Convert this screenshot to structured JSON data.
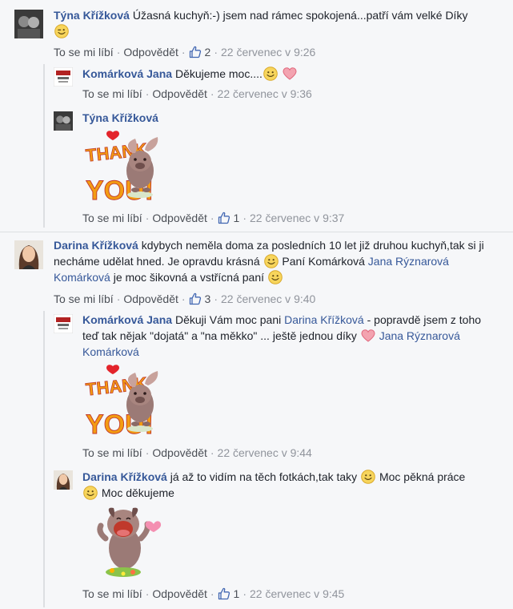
{
  "actions": {
    "like": "To se mi líbí",
    "reply": "Odpovědět",
    "sep": "·"
  },
  "comments": [
    {
      "author": "Týna Křížková",
      "text": "Úžasná kuchyň:-) jsem nad rámec spokojená...patří vám velké Díky",
      "likes": "2",
      "time": "22 červenec v 9:26",
      "replies": [
        {
          "author": "Komárková Jana",
          "text": "Děkujeme moc....",
          "time": "22 červenec v 9:36"
        },
        {
          "author": "Týna Křížková",
          "sticker": "thank-you-sticker",
          "likes": "1",
          "time": "22 červenec v 9:37"
        }
      ]
    },
    {
      "author": "Darina Křížková",
      "text_1": "kdybych neměla doma za posledních 10 let již druhou kuchyň,tak si ji necháme udělat hned. Je opravdu krásná",
      "text_2": "Paní Komárková",
      "tag_1": "Jana Rýznarová Komárková",
      "text_3": "je moc šikovná a vstřícná paní",
      "likes": "3",
      "time": "22 červenec v 9:40",
      "replies": [
        {
          "author": "Komárková Jana",
          "text_1": "Děkuji Vám moc pani",
          "tag_1": "Darina Křížková",
          "text_2": "- popravdě jsem z toho teď tak nějak \"dojatá\" a \"na měkko\" ... ještě jednou díky",
          "tag_2": "Jana Rýznarová Komárková",
          "sticker": "thank-you-sticker",
          "time": "22 červenec v 9:44"
        },
        {
          "author": "Darina Křížková",
          "text_1": "já až to vidím na těch fotkách,tak taky",
          "text_2": "Moc pěkná práce",
          "text_3": "Moc děkujeme",
          "sticker": "heart-pug-sticker",
          "likes": "1",
          "time": "22 červenec v 9:45"
        }
      ]
    }
  ],
  "sticker_text": {
    "thank": "THANK",
    "you": "YOU!"
  },
  "colors": {
    "link": "#365899",
    "meta": "#4b4f56",
    "time": "#90949c",
    "bg": "#f6f7f9",
    "heart": "#e8788a",
    "emoji": "#f7d55c"
  }
}
